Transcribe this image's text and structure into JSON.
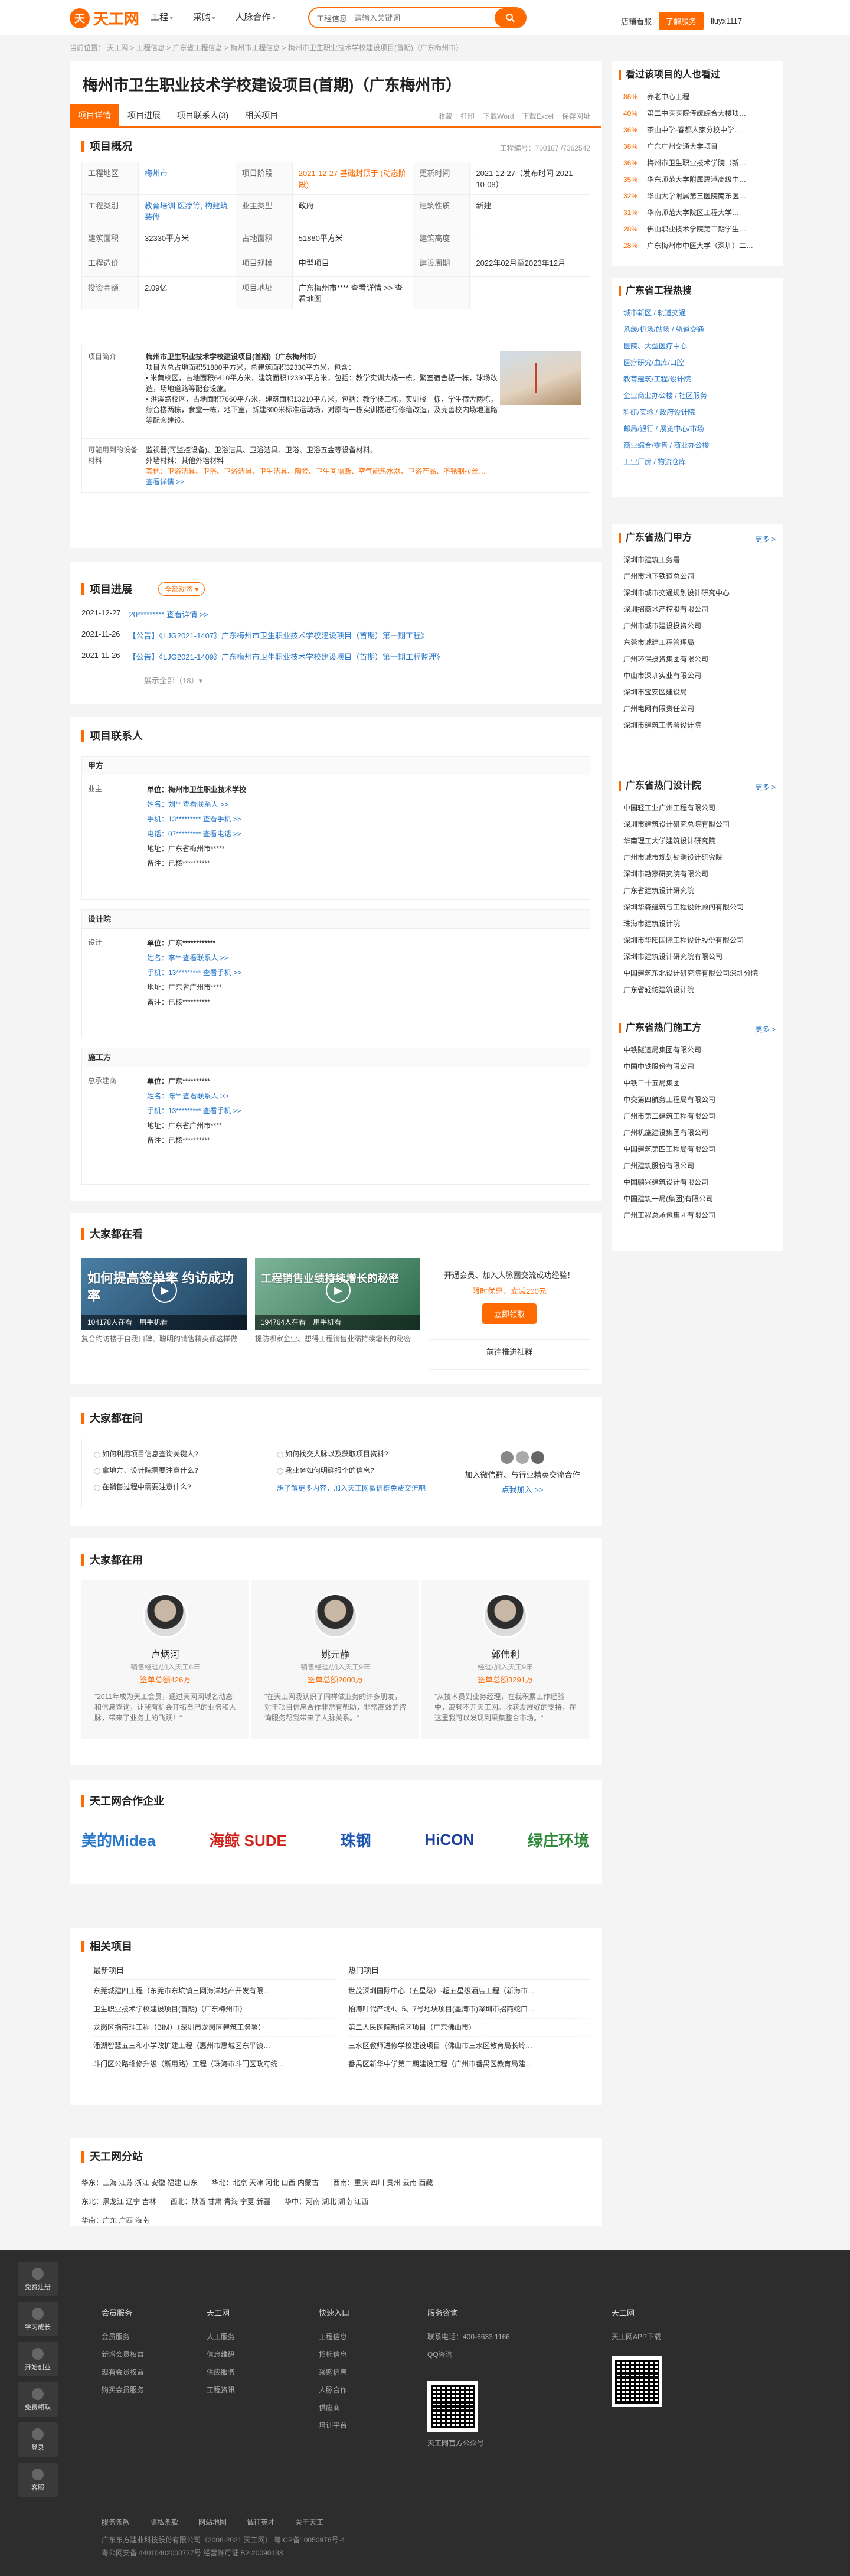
{
  "header": {
    "logo_text": "天工网",
    "nav": [
      "工程",
      "采购",
      "人脉合作"
    ],
    "search_category": "工程信息",
    "search_placeholder": "请输入关键词",
    "links": [
      "店铺看服"
    ],
    "login": "了解服务",
    "user": "lluyx1117"
  },
  "breadcrumb": "当前位置： 天工网 > 工程信息 > 广东省工程信息 > 梅州市工程信息 > 梅州市卫生职业技术学校建设项目(首期)（广东梅州市）",
  "project": {
    "title": "梅州市卫生职业技术学校建设项目(首期)（广东梅州市）",
    "tabs": [
      "项目详情",
      "项目进展",
      "项目联系人(3)",
      "相关项目"
    ],
    "tools": [
      "收藏",
      "打印",
      "下载Word",
      "下载Excel",
      "保存网址"
    ],
    "overview_label": "项目概况",
    "project_no": "工程编号：700187 /7362542",
    "rows": [
      [
        {
          "k": "工程地区",
          "v": "梅州市",
          "c": "b"
        },
        {
          "k": "项目阶段",
          "v": "2021-12-27 基础封顶于 (动态阶段)",
          "c": "o"
        },
        {
          "k": "更新时间",
          "v": "2021-12-27（发布时间 2021-10-08）",
          "c": ""
        }
      ],
      [
        {
          "k": "工程类别",
          "v": "教育培训 医疗等, 构建筑装修",
          "c": "b"
        },
        {
          "k": "业主类型",
          "v": "政府",
          "c": ""
        },
        {
          "k": "建筑性质",
          "v": "新建",
          "c": ""
        }
      ],
      [
        {
          "k": "建筑面积",
          "v": "32330平方米",
          "c": ""
        },
        {
          "k": "占地面积",
          "v": "51880平方米",
          "c": ""
        },
        {
          "k": "建筑高度",
          "v": "--",
          "c": ""
        }
      ],
      [
        {
          "k": "工程造价",
          "v": "--",
          "c": ""
        },
        {
          "k": "项目规模",
          "v": "中型项目",
          "c": ""
        },
        {
          "k": "建设周期",
          "v": "2022年02月至2023年12月",
          "c": ""
        }
      ],
      [
        {
          "k": "投资金额",
          "v": "2.09亿",
          "c": ""
        },
        {
          "k": "项目地址",
          "v": "广东梅州市**** 查看详情 >> 查看地图",
          "c": ""
        },
        {
          "k": "",
          "v": "",
          "c": ""
        }
      ]
    ],
    "intro_label": "项目简介",
    "intro_title": "梅州市卫生职业技术学校建设项目(首期)（广东梅州市）",
    "intro_lines": [
      "项目为总占地面积51880平方米，总建筑面积32330平方米，包含：",
      "• 米黄校区，占地面积6410平方米，建筑面积12330平方米，包括：教学实训大楼一栋，繁室宿舍楼一栋，球场改造，场地道路等配套设施。",
      "• 洪溪路校区，占地面积7660平方米，建筑面积13210平方米，包括：教学楼三栋，实训楼一栋，学生宿舍两栋，综合楼两栋，食堂一栋，地下室，新建300米标准运动场，对原有一栋实训楼进行修缮改造，及完善校内场地道路等配套建设。"
    ],
    "mat_label": "可能用到的设备材料",
    "mat_lines": [
      "监视器(可监控设备)、卫浴洁具、卫浴洁具、卫浴、卫浴五金等设备材料。",
      "外墙材料：其他外墙材料",
      "其他：卫浴洁具、卫浴、卫浴洁具、卫生洁具、陶瓷、卫生间隔断、空气能热水器、卫浴产品、不锈钢拉丝…",
      "查看详情 >>"
    ]
  },
  "progress": {
    "label": "项目进展",
    "chip": "全部动态 ▾",
    "items": [
      {
        "date": "2021-12-27",
        "text": "20********* 查看详情 >>"
      },
      {
        "date": "2021-11-26",
        "text": "【公告】《LJG2021-1407》广东梅州市卫生职业技术学校建设项目（首期）第一期工程》"
      },
      {
        "date": "2021-11-26",
        "text": "【公告】《LJG2021-1409》广东梅州市卫生职业技术学校建设项目（首期）第一期工程监理》"
      }
    ],
    "more": "展示全部（18）▾"
  },
  "contacts": {
    "label": "项目联系人",
    "groups": [
      {
        "title": "甲方",
        "role": "业主",
        "rows": [
          "单位：梅州市卫生职业技术学校",
          "姓名：刘** 查看联系人 >>",
          "手机：13********* 查看手机 >>",
          "电话：07********* 查看电话 >>",
          "地址：广东省梅州市*****",
          "备注：已核**********"
        ]
      },
      {
        "title": "设计院",
        "role": "设计",
        "rows": [
          "单位：广东************",
          "姓名：李** 查看联系人 >>",
          "手机：13********* 查看手机 >>",
          "地址：广东省广州市****",
          "备注：已核**********"
        ]
      },
      {
        "title": "施工方",
        "role": "总承建商",
        "rows": [
          "单位：广东**********",
          "姓名：陈** 查看联系人 >>",
          "手机：13********* 查看手机 >>",
          "地址：广东省广州市****",
          "备注：已核**********"
        ]
      }
    ]
  },
  "videos": {
    "label": "大家都在看",
    "items": [
      {
        "cap": "如何提高签单率 约访成功率",
        "views": "104178人在看",
        "tag": "用手机看",
        "desc": "复合约访楼于自我口碑、聪明的销售精英都这样做"
      },
      {
        "cap": "工程销售业绩持续增长的秘密",
        "views": "194764人在看",
        "tag": "用手机看",
        "desc": "提防哪家企业、想得工程销售业绩持续增长的秘密"
      }
    ],
    "promo": "开通会员、加入人脉圈交流成功经验！",
    "promo_price": "限时优惠、立减200元",
    "promo_btn": "立即领取",
    "promo_link": "前往推进社群"
  },
  "qa": {
    "label": "大家都在问",
    "items": [
      "如何利用项目信息查询关键人?",
      "如何找交人脉以及获取项目资料?",
      "拿地方、设计院需要注意什么?",
      "我业务如何明确报个的信息?",
      "在销售过程中需要注意什么?",
      "想了解更多内容，加入天工网微信群免费交流吧"
    ],
    "side": "加入微信群、与行业精英交流合作",
    "side_link": "点我加入 >>"
  },
  "usage": {
    "label": "大家都在用",
    "cards": [
      {
        "name": "卢炳河",
        "pos": "销售经理/加入天工6年",
        "amt": "签单总额426万",
        "quote": "\"2011年成为天工会员，通过天网网域名动态和信息查询，让我有机会开拓自己的业务和人脉，带来了业务上的飞跃！\""
      },
      {
        "name": "姚元静",
        "pos": "销售经理/加入天工9年",
        "amt": "签单总额2000万",
        "quote": "\"在天工网我认识了同样做业务的许多朋友，对于项目信息合作非常有帮助，非常高效的咨询服务帮我带来了人脉关系。\""
      },
      {
        "name": "郭伟利",
        "pos": "经理/加入天工9年",
        "amt": "签单总额3291万",
        "quote": "\"从技术员到业务经理，在我积累工作经验中，离频不开天工网。收获发展好的支持，在这里我可以发现到采集整合市场。\""
      }
    ]
  },
  "partners": {
    "label": "天工网合作企业",
    "items": [
      "美的Midea",
      "海鲸 SUDE",
      "珠钢",
      "HiCON",
      "绿庄环境"
    ]
  },
  "related": {
    "label": "相关项目",
    "left_title": "最新项目",
    "right_title": "热门项目",
    "left": [
      "东莞城建四工程（东莞市东坑镇三网海洋地产开发有限…",
      "卫生职业技术学校建设项目(首期)（广东梅州市）",
      "龙岗区指南理工程（BIM）（深圳市龙岗区建筑工务署）",
      "潘湖智慧五三和小学改扩建工程（惠州市惠城区东平镇…",
      "斗门区公路维修升级（斯用路）工程（珠海市斗门区政府统…"
    ],
    "right": [
      "世茂深圳国际中心（五星级）-超五星级酒店工程（新海市…",
      "柏海叶代产场4、5、7号地块项目(墨湾市)深圳市招商蛇口…",
      "第二人民医院新院区项目（广东佛山市）",
      "三水区教师进修学校建设项目（佛山市三水区教育局长岭…",
      "番禺区新华中学第二期建设工程（广州市番禺区教育局建…"
    ]
  },
  "branches": {
    "label": "天工网分站",
    "rows": [
      "华东：上海 江苏 浙江 安徽 福建 山东　　华北：北京 天津 河北 山西 内蒙古　　西南：重庆 四川 贵州 云南 西藏",
      "东北：黑龙江 辽宁 吉林　　西北：陕西 甘肃 青海 宁夏 新疆　　华中：河南 湖北 湖南 江西",
      "华南：广东 广西 海南"
    ]
  },
  "sidebar": {
    "viewed": {
      "title": "看过该项目的人也看过",
      "items": [
        {
          "p": "86%",
          "t": "养老中心工程"
        },
        {
          "p": "40%",
          "t": "第二中医医院传统综合大楼项…"
        },
        {
          "p": "36%",
          "t": "茶山中学-春都人家分校中学…"
        },
        {
          "p": "36%",
          "t": "广东广州交通大学项目"
        },
        {
          "p": "36%",
          "t": "梅州市卫生职业技术学院（新…"
        },
        {
          "p": "35%",
          "t": "华东师范大学附属惠港高级中…"
        },
        {
          "p": "32%",
          "t": "华山大学附属第三医院南东医…"
        },
        {
          "p": "31%",
          "t": "华南师范大学院区工程大学…"
        },
        {
          "p": "28%",
          "t": "佛山职业技术学院第二期学生…"
        },
        {
          "p": "28%",
          "t": "广东梅州市中医大学（深圳）二…"
        }
      ]
    },
    "hotwords": {
      "title": "广东省工程热搜",
      "items": [
        "城市新区 / 轨道交通",
        "系统/机场/站场 / 轨道交通",
        "医院、大型医疗中心",
        "医疗研究/血库/口腔",
        "教育建筑/工程/设计院",
        "企业商业办公楼 / 社区服务",
        "科研/实验 / 政府设计院",
        "邮局/银行 / 展览中心/市场",
        "商业综合/零售 / 商业办公楼",
        "工业厂房 / 物流仓库"
      ]
    },
    "clients": {
      "title": "广东省热门甲方",
      "more": "更多 >",
      "items": [
        "深圳市建筑工务署",
        "广州市地下铁道总公司",
        "深圳市城市交通规划设计研究中心",
        "深圳招商地产控股有限公司",
        "广州市城市建设投资公司",
        "东莞市城建工程管理局",
        "广州环保投资集团有限公司",
        "中山市深圳实业有限公司",
        "深圳市宝安区建设局",
        "广州电网有限责任公司",
        "深圳市建筑工务署设计院"
      ]
    },
    "design": {
      "title": "广东省热门设计院",
      "more": "更多 >",
      "items": [
        "中国轻工业广州工程有限公司",
        "深圳市建筑设计研究总院有限公司",
        "华南理工大学建筑设计研究院",
        "广州市城市规划勘测设计研究院",
        "深圳市勘察研究院有限公司",
        "广东省建筑设计研究院",
        "深圳华森建筑与工程设计顾问有限公司",
        "珠海市建筑设计院",
        "深圳市华阳国际工程设计股份有限公司",
        "深圳市建筑设计研究院有限公司",
        "中国建筑东北设计研究院有限公司深圳分院",
        "广东省轻纺建筑设计院"
      ]
    },
    "builders": {
      "title": "广东省热门施工方",
      "more": "更多 >",
      "items": [
        "中铁隧道局集团有限公司",
        "中国中铁股份有限公司",
        "中铁二十五局集团",
        "中交第四航务工程局有限公司",
        "广州市第二建筑工程有限公司",
        "广州机施建设集团有限公司",
        "中国建筑第四工程局有限公司",
        "广州建筑股份有限公司",
        "中国鹏兴建筑设计有限公司",
        "中国建筑一局(集团)有限公司",
        "广州工程总承包集团有限公司"
      ]
    }
  },
  "footer": {
    "side_buttons": [
      "免费注册",
      "学习成长",
      "开始创业",
      "免费领取",
      "登录",
      "客服"
    ],
    "cols": [
      {
        "h": "会员服务",
        "items": [
          "会员服务",
          "新增会员权益",
          "现有会员权益",
          "购买会员服务"
        ]
      },
      {
        "h": "天工网",
        "items": [
          "人工服务",
          "信息维码",
          "供应服务",
          "工程资讯"
        ]
      },
      {
        "h": "快速入口",
        "items": [
          "工程信息",
          "招标信息",
          "采购信息",
          "人脉合作",
          "供应商",
          "培训平台"
        ]
      },
      {
        "h": "服务咨询",
        "items": [
          "联系电话：400-6633 1166",
          "QQ咨询"
        ]
      },
      {
        "h": "天工网",
        "items": [
          "天工网APP下载"
        ]
      }
    ],
    "qr_caption": "天工网官方公众号",
    "links": [
      "服务条款",
      "隐私条款",
      "网站地图",
      "诚征英才",
      "关于天工"
    ],
    "copy": [
      "广东东方建业科技股份有限公司（2006-2021 天工网） 粤ICP备10050976号-4",
      "粤公网安备 44010402000727号 经营许可证 B2-20090138"
    ]
  }
}
